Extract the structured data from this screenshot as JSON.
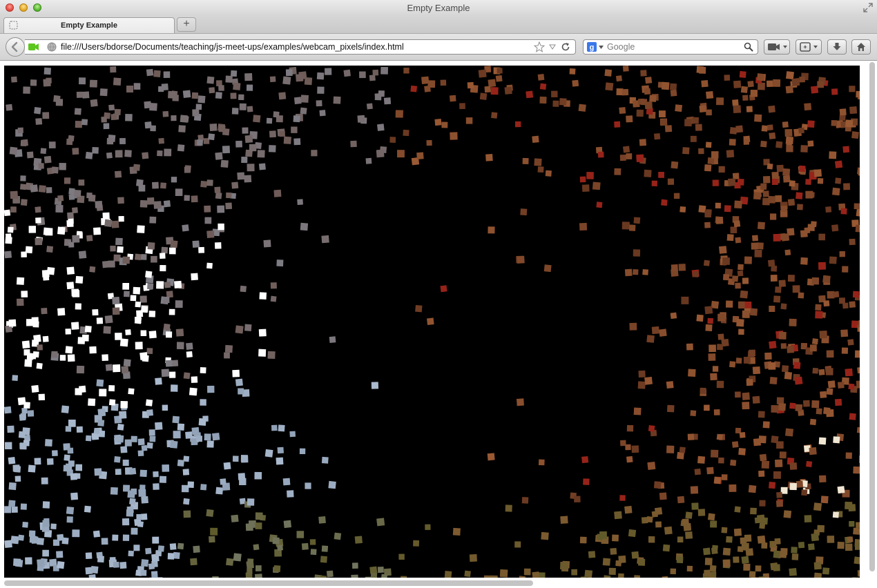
{
  "window": {
    "title": "Empty Example"
  },
  "tabs": [
    {
      "label": "Empty Example",
      "active": true
    }
  ],
  "toolbar": {
    "new_tab_label": "+",
    "address": "file:///Users/bdorse/Documents/teaching/js-meet-ups/examples/webcam_pixels/index.html",
    "search_placeholder": "Google",
    "search_engine": "google-icon",
    "icons": [
      "back-arrow-icon",
      "camera-indicator-icon",
      "globe-icon",
      "star-icon",
      "reload-icon",
      "video-camera-icon",
      "screenshot-icon",
      "download-icon",
      "home-icon"
    ]
  },
  "colors": {
    "canvas_background": "#000000",
    "cool_particle": "#8fa0b5",
    "warm_particle": "#9a5a34",
    "bright_particle": "#ffffff",
    "olive_particle": "#5f5a2a"
  }
}
